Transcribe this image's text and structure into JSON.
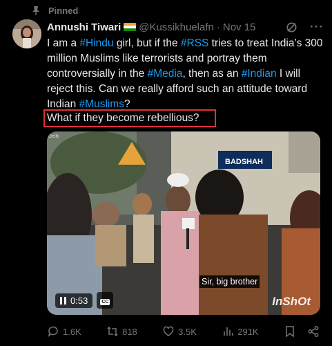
{
  "pinned_label": "Pinned",
  "author": {
    "name": "Annushi Tiwari",
    "handle": "@Kussikhuelafn",
    "separator": "·",
    "date": "Nov 15"
  },
  "tweet": {
    "t1": "I am a ",
    "tag_hindu": "#Hindu",
    "t2": " girl, but if the ",
    "tag_rss": "#RSS",
    "t3": " tries to treat India’s 300 million Muslims like terrorists and portray them controversially in the ",
    "tag_media": "#Media",
    "t4": ", then as an ",
    "tag_indian": "#Indian",
    "t5": " I will reject this. Can we really afford such an attitude toward Indian ",
    "tag_muslims": "#Muslims",
    "t6": "?",
    "highlighted_line": "What if they become rebellious?"
  },
  "video": {
    "caption": "Sir, big brother",
    "time": "0:53",
    "cc_label": "CC",
    "watermark": "InShOt",
    "corner_text": "Delhi",
    "sign_text": "BADSHAH"
  },
  "actions": {
    "replies": "1.6K",
    "reposts": "818",
    "likes": "3.5K",
    "views": "291K"
  },
  "colors": {
    "link": "#1d9bf0",
    "muted": "#71767b",
    "highlight_border": "#e0303a",
    "background": "#000000"
  },
  "icons": [
    "pin-icon",
    "grok-icon",
    "more-icon",
    "pause-icon",
    "cc-icon",
    "reply-icon",
    "repost-icon",
    "like-icon",
    "views-icon",
    "bookmark-icon",
    "share-icon"
  ]
}
